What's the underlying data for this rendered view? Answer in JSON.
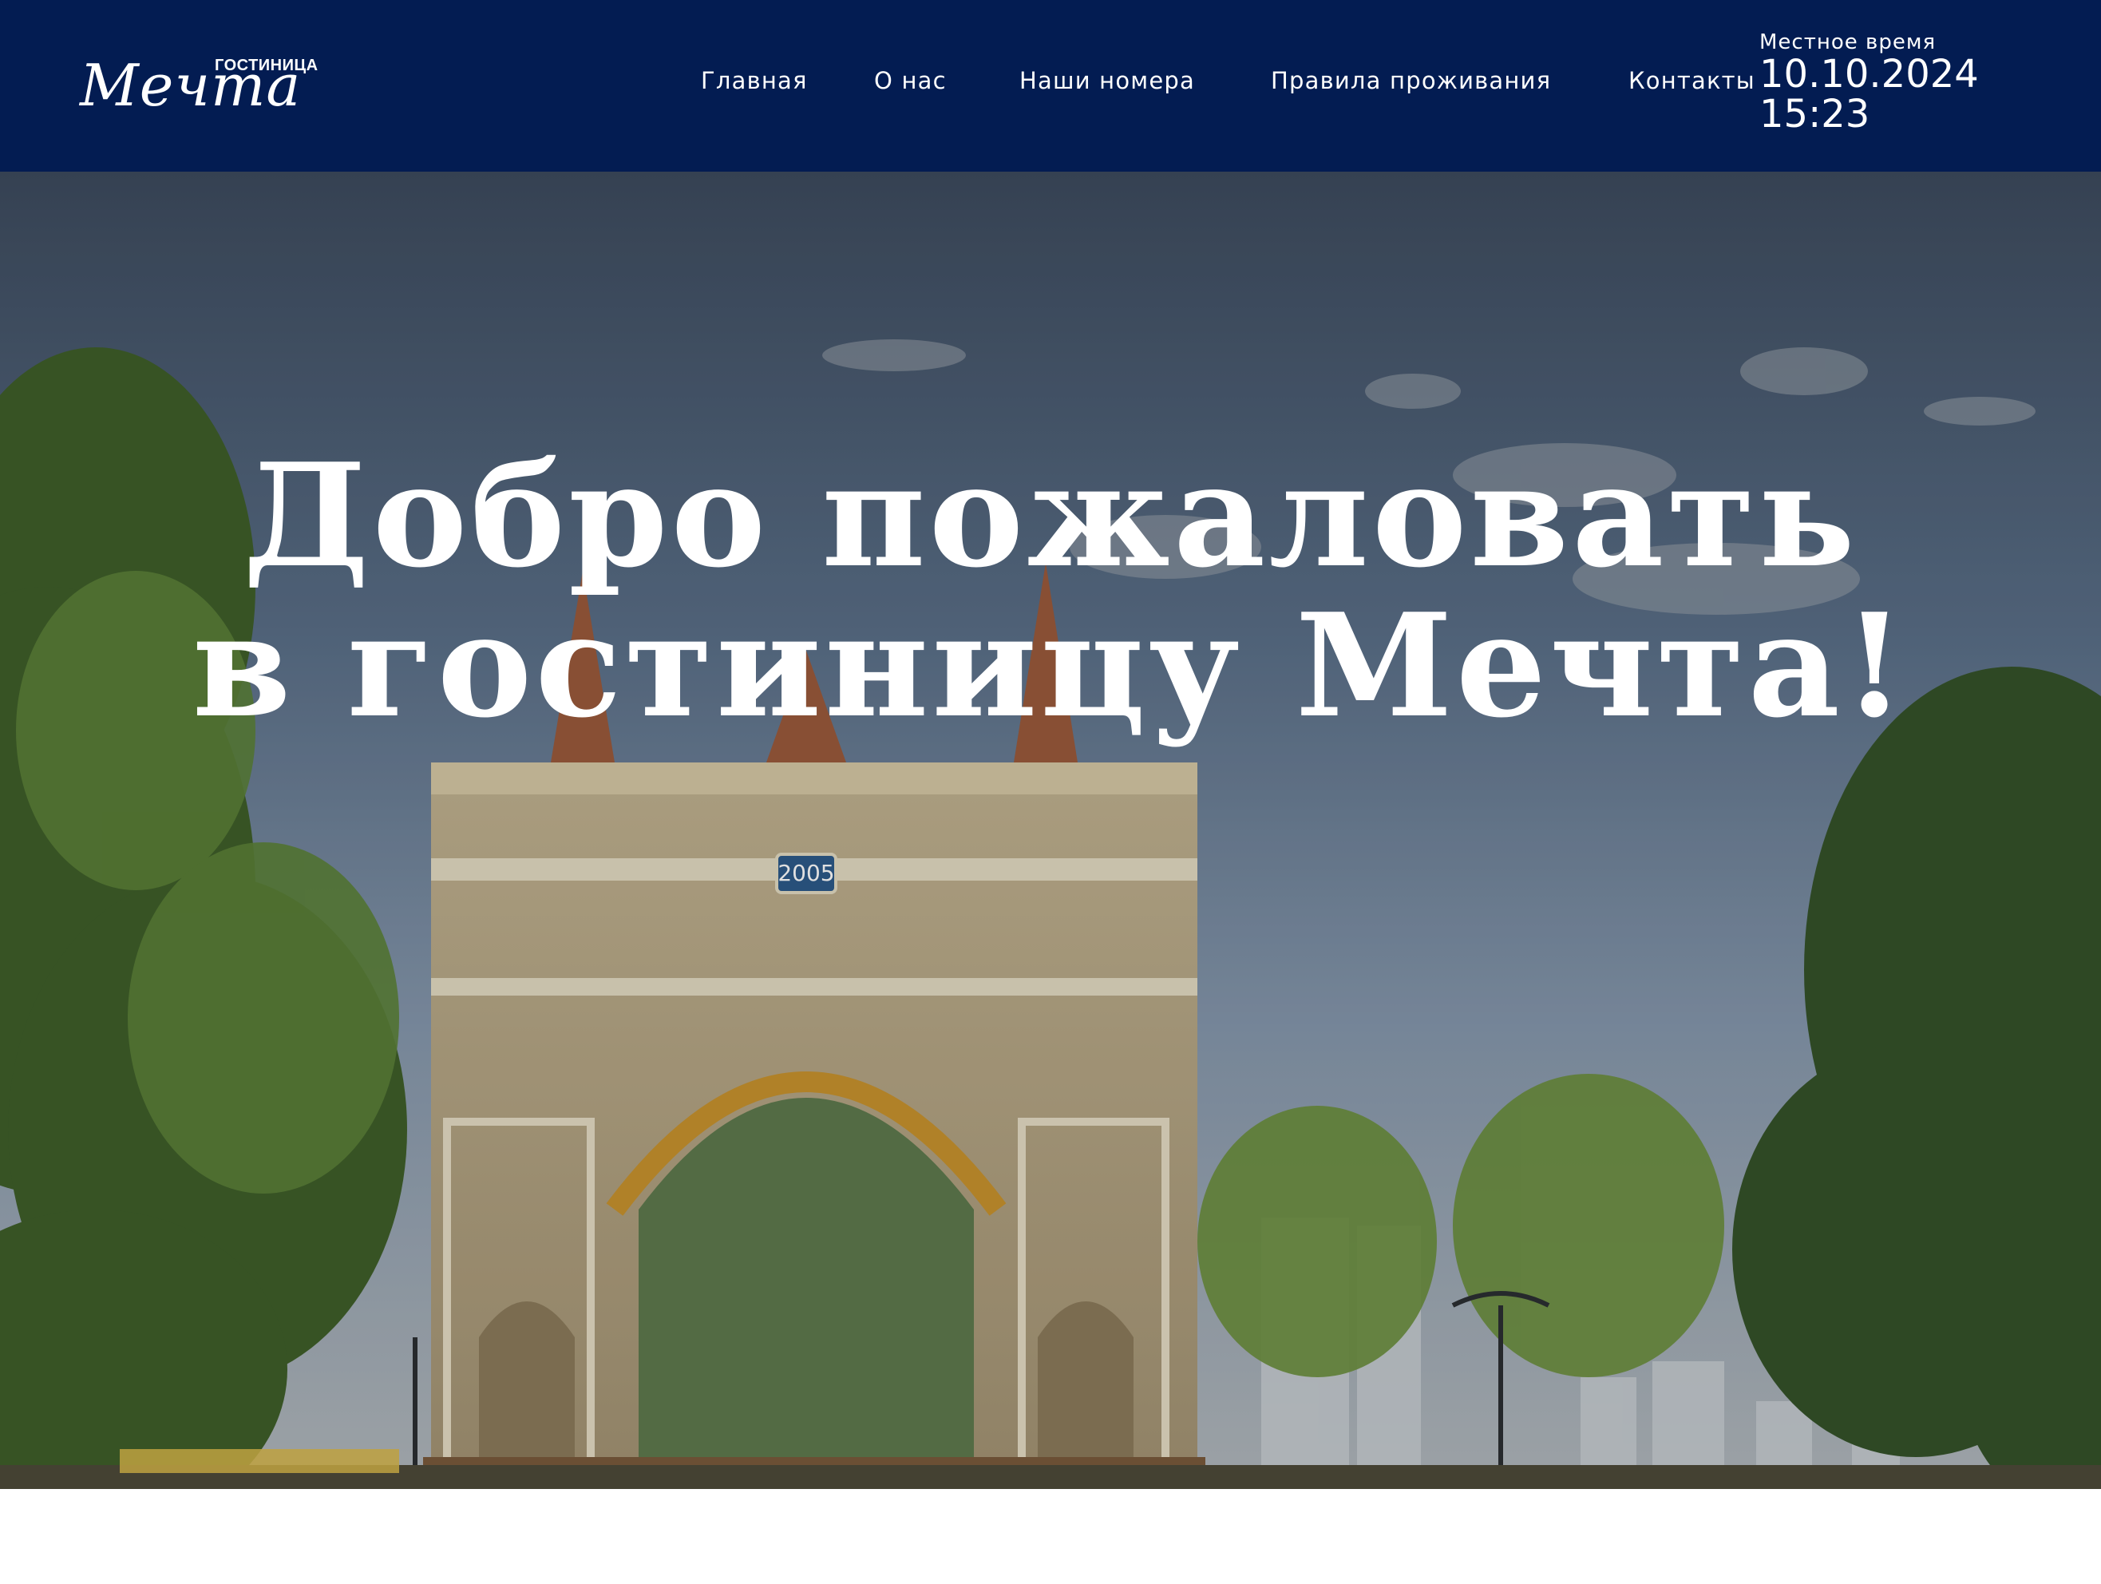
{
  "header": {
    "logo": {
      "small_text": "ГОСТИНИЦА",
      "big_text": "Мечта"
    },
    "nav": [
      {
        "label": "Главная"
      },
      {
        "label": "О нас"
      },
      {
        "label": "Наши номера"
      },
      {
        "label": "Правила проживания"
      },
      {
        "label": "Контакты"
      }
    ],
    "clock": {
      "label": "Местное время",
      "date": "10.10.2024",
      "time": "15:23"
    }
  },
  "hero": {
    "title_line1": "Добро пожаловать",
    "title_line2": "в гостиницу Мечта!",
    "arch_year": "2005"
  },
  "colors": {
    "header_bg": "#031c52",
    "text_light": "#ffffff"
  }
}
